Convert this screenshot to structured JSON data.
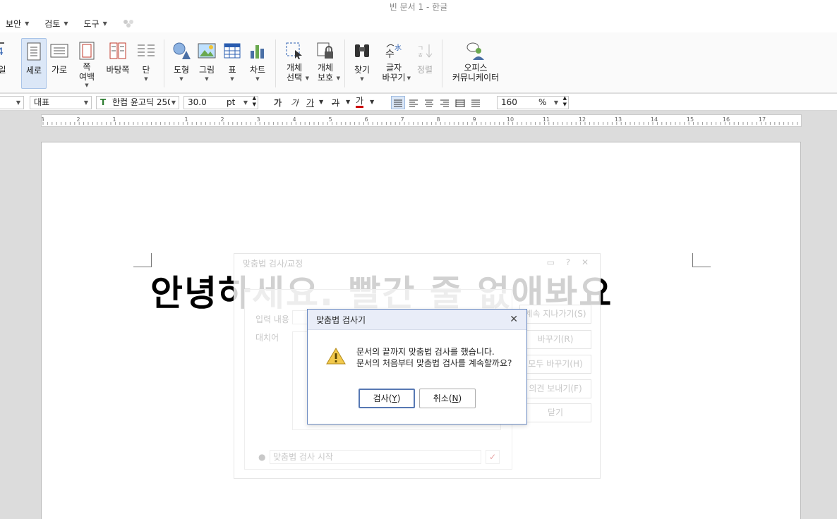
{
  "window": {
    "title": "빈 문서 1 - 한글"
  },
  "menu": {
    "items": [
      "보안",
      "검토",
      "도구"
    ]
  },
  "ribbon": {
    "partial_left": "파\n일",
    "buttons": {
      "portrait": "세로",
      "landscape": "가로",
      "margin": "쪽\n여백",
      "background": "바탕쪽",
      "columns": "단",
      "shape": "도형",
      "picture": "그림",
      "table": "표",
      "chart": "차트",
      "select_object": "개체\n선택",
      "protect_object": "개체\n보호",
      "find": "찾기",
      "replace_char": "글자\n바꾸기",
      "sort": "정렬",
      "office_communicator": "오피스\n커뮤니케이터"
    }
  },
  "format_bar": {
    "style": "대표",
    "font": "한컴 윤고딕 250",
    "font_size": "30.0",
    "size_unit": "pt",
    "zoom": "160",
    "zoom_unit": "%"
  },
  "document": {
    "text": "안녕하세요. 빨간 줄 없애봐요"
  },
  "bg_dialog": {
    "title": "맞춤법 검사/교정",
    "input_label": "입력 내용",
    "replace_label": "대치어",
    "status": "맞춤법 검사 시작",
    "buttons": [
      "계속 지나가기(S)",
      "바꾸기(R)",
      "모두 바꾸기(H)",
      "의견 보내기(F)",
      "닫기"
    ]
  },
  "modal": {
    "title": "맞춤법 검사기",
    "line1": "문서의 끝까지 맞춤법 검사를 했습니다.",
    "line2": "문서의 처음부터 맞춤법 검사를 계속할까요?",
    "ok_label": "검사",
    "ok_key": "Y",
    "cancel_label": "취소",
    "cancel_key": "N"
  }
}
